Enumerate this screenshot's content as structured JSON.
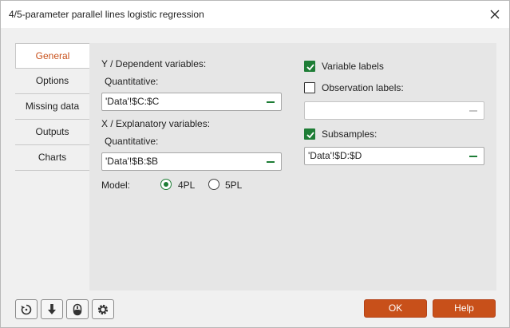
{
  "window": {
    "title": "4/5-parameter parallel lines logistic regression"
  },
  "tabs": [
    {
      "label": "General",
      "active": true
    },
    {
      "label": "Options"
    },
    {
      "label": "Missing data"
    },
    {
      "label": "Outputs"
    },
    {
      "label": "Charts"
    }
  ],
  "general": {
    "y_header": "Y / Dependent variables:",
    "y_quant_label": "Quantitative:",
    "y_quant_value": "'Data'!$C:$C",
    "x_header": "X / Explanatory variables:",
    "x_quant_label": "Quantitative:",
    "x_quant_value": "'Data'!$B:$B",
    "model_label": "Model:",
    "model_options": [
      {
        "label": "4PL",
        "selected": true
      },
      {
        "label": "5PL",
        "selected": false
      }
    ],
    "variable_labels": {
      "label": "Variable labels",
      "checked": true
    },
    "observation_labels": {
      "label": "Observation labels:",
      "checked": false,
      "value": ""
    },
    "subsamples": {
      "label": "Subsamples:",
      "checked": true,
      "value": "'Data'!$D:$D"
    }
  },
  "footer": {
    "icons": [
      "reset-icon",
      "load-icon",
      "mouse-icon",
      "settings-icon"
    ],
    "ok_label": "OK",
    "help_label": "Help"
  },
  "colors": {
    "accent": "#c8501a",
    "check_green": "#1e7d36"
  }
}
